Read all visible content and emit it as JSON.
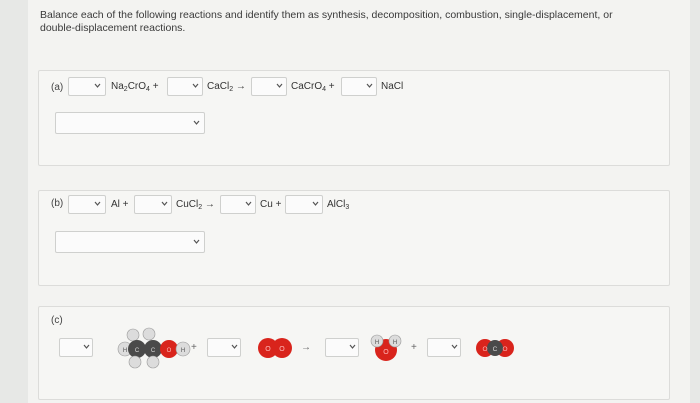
{
  "instructions": "Balance each of the following reactions and identify them as synthesis, decomposition, combustion, single-displacement, or double-displacement reactions.",
  "parts": {
    "a": {
      "label": "(a)",
      "terms": [
        {
          "base": "Na",
          "sub1": "2",
          "mid": "CrO",
          "sub2": "4",
          "tail": " +"
        },
        {
          "base": "CaCl",
          "sub1": "2",
          "mid": "",
          "sub2": "",
          "tail": " →"
        },
        {
          "base": "CaCrO",
          "sub1": "4",
          "mid": "",
          "sub2": "",
          "tail": " +"
        },
        {
          "base": "NaCl",
          "sub1": "",
          "mid": "",
          "sub2": "",
          "tail": ""
        }
      ]
    },
    "b": {
      "label": "(b)",
      "terms": [
        {
          "base": "Al",
          "sub1": "",
          "mid": "",
          "sub2": "",
          "tail": " +"
        },
        {
          "base": "CuCl",
          "sub1": "2",
          "mid": "",
          "sub2": "",
          "tail": " →"
        },
        {
          "base": "Cu",
          "sub1": "",
          "mid": "",
          "sub2": "",
          "tail": " +"
        },
        {
          "base": "AlCl",
          "sub1": "3",
          "mid": "",
          "sub2": "",
          "tail": ""
        }
      ]
    },
    "c": {
      "label": "(c)",
      "operators": [
        "+",
        "→",
        "+"
      ],
      "molecule_labels": {
        "hydrocarbon_h": "H",
        "hydrocarbon_c": "C",
        "oxygen": "O",
        "water_h": "H",
        "water_o": "O",
        "co2_o": "O",
        "co2_c": "C"
      }
    }
  },
  "colors": {
    "oxygen": "#d9241c",
    "carbon": "#4a4a4a",
    "hydrogen": "#e8e8e8"
  }
}
